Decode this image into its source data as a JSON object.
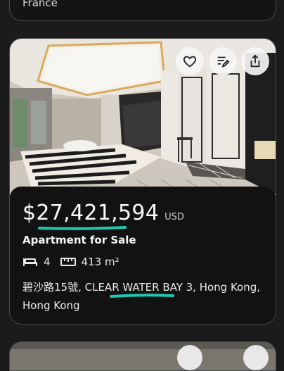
{
  "previous_listing": {
    "location": "France"
  },
  "listing": {
    "price": "$27,421,594",
    "currency": "USD",
    "property_type": "Apartment for Sale",
    "bedrooms": "4",
    "area": "413 m²",
    "address": "碧沙路15號, CLEAR WATER BAY 3, Hong Kong, Hong Kong",
    "actions": [
      "heart-icon",
      "notes-icon",
      "share-icon"
    ]
  },
  "colors": {
    "highlight": "#1ec9b1",
    "card_bg": "#121212",
    "page_bg": "#1b1b1b",
    "border": "#4a4a4a"
  }
}
